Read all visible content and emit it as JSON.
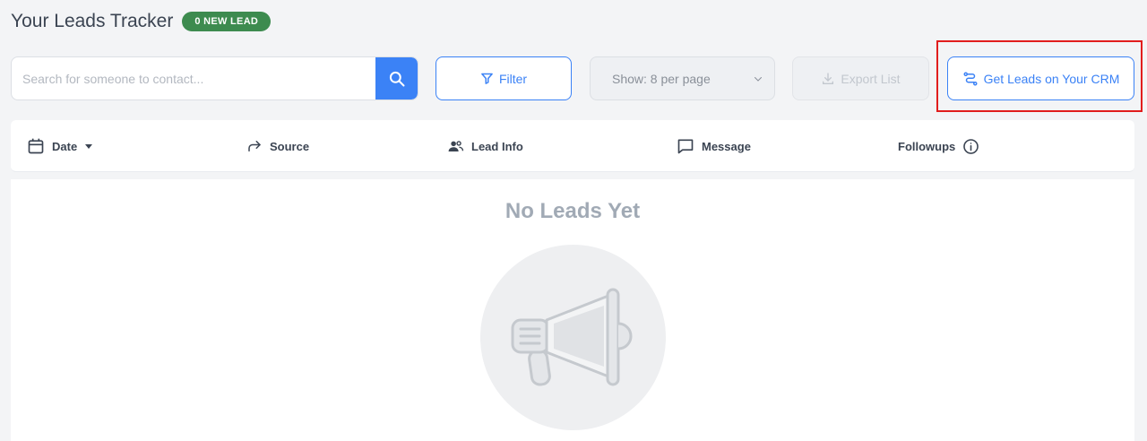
{
  "header": {
    "title": "Your Leads Tracker",
    "badge": "0 NEW LEAD"
  },
  "toolbar": {
    "search_placeholder": "Search for someone to contact...",
    "filter_label": "Filter",
    "show_label": "Show: 8 per page",
    "export_label": "Export List",
    "crm_label": "Get Leads on Your CRM"
  },
  "table": {
    "columns": [
      {
        "label": "Date",
        "icon": "calendar-icon"
      },
      {
        "label": "Source",
        "icon": "share-arrow-icon"
      },
      {
        "label": "Lead Info",
        "icon": "people-icon"
      },
      {
        "label": "Message",
        "icon": "message-icon"
      },
      {
        "label": "Followups",
        "icon": "info-icon"
      }
    ]
  },
  "empty_state": {
    "title": "No Leads Yet",
    "icon": "megaphone-icon"
  },
  "colors": {
    "accent": "#3b82f6",
    "badge": "#3d8b4f",
    "highlight": "#e11d1d"
  }
}
